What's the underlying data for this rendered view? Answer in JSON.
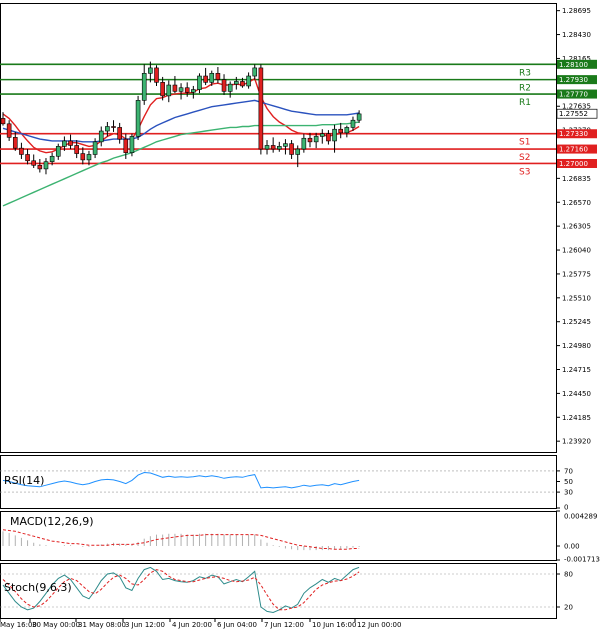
{
  "chart_data": [
    {
      "type": "candlestick",
      "panel": "price",
      "ylim": [
        1.238,
        1.2878
      ],
      "y_ticks": [
        "1.28695",
        "1.28430",
        "1.28165",
        "1.27635",
        "1.27370",
        "1.26835",
        "1.26570",
        "1.26305",
        "1.26040",
        "1.25775",
        "1.25510",
        "1.25245",
        "1.24980",
        "1.24715",
        "1.24450",
        "1.24185",
        "1.23920"
      ],
      "x_ticks": [
        "May 16:00",
        "30 May 00:00",
        "31 May 08:00",
        "3 Jun 12:00",
        "4 Jun 20:00",
        "6 Jun 04:00",
        "7 Jun 12:00",
        "10 Jun 16:00",
        "12 Jun 00:00"
      ],
      "levels": [
        {
          "label": "R3",
          "value": 1.281,
          "value_label": "1.28100",
          "color": "#1a7a1a"
        },
        {
          "label": "R2",
          "value": 1.2793,
          "value_label": "1.27930",
          "color": "#1a7a1a"
        },
        {
          "label": "R1",
          "value": 1.2777,
          "value_label": "1.27770",
          "color": "#1a7a1a"
        },
        {
          "label": "S1",
          "value": 1.2733,
          "value_label": "1.27330",
          "color": "#e02020"
        },
        {
          "label": "S2",
          "value": 1.2716,
          "value_label": "1.27160",
          "color": "#e02020"
        },
        {
          "label": "S3",
          "value": 1.27,
          "value_label": "1.27000",
          "color": "#e02020"
        }
      ],
      "current_price": {
        "value": 1.27552,
        "label": "1.27552"
      },
      "candles": [
        [
          1.275,
          1.2757,
          1.2742,
          1.2744
        ],
        [
          1.2744,
          1.2748,
          1.2725,
          1.2729
        ],
        [
          1.2729,
          1.2735,
          1.2714,
          1.2717
        ],
        [
          1.2717,
          1.2723,
          1.2705,
          1.271
        ],
        [
          1.271,
          1.2716,
          1.2699,
          1.2703
        ],
        [
          1.2703,
          1.271,
          1.2695,
          1.2698
        ],
        [
          1.2698,
          1.2705,
          1.269,
          1.2694
        ],
        [
          1.2694,
          1.2706,
          1.2688,
          1.2702
        ],
        [
          1.2702,
          1.2712,
          1.2698,
          1.2708
        ],
        [
          1.2708,
          1.2722,
          1.2704,
          1.2719
        ],
        [
          1.2719,
          1.273,
          1.2714,
          1.2725
        ],
        [
          1.2725,
          1.2732,
          1.2716,
          1.272
        ],
        [
          1.272,
          1.2726,
          1.2706,
          1.2711
        ],
        [
          1.2711,
          1.2718,
          1.2699,
          1.2704
        ],
        [
          1.2704,
          1.2714,
          1.2698,
          1.271
        ],
        [
          1.271,
          1.2728,
          1.2706,
          1.2724
        ],
        [
          1.2724,
          1.2741,
          1.2719,
          1.2736
        ],
        [
          1.2736,
          1.2746,
          1.273,
          1.2741
        ],
        [
          1.2741,
          1.2748,
          1.2735,
          1.274
        ],
        [
          1.274,
          1.2745,
          1.2722,
          1.2727
        ],
        [
          1.2727,
          1.2733,
          1.2705,
          1.2712
        ],
        [
          1.2712,
          1.2733,
          1.2708,
          1.273
        ],
        [
          1.273,
          1.2775,
          1.2726,
          1.277
        ],
        [
          1.277,
          1.281,
          1.2765,
          1.28
        ],
        [
          1.28,
          1.2813,
          1.279,
          1.2806
        ],
        [
          1.2806,
          1.2809,
          1.2786,
          1.279
        ],
        [
          1.279,
          1.2796,
          1.277,
          1.2775
        ],
        [
          1.2775,
          1.2792,
          1.2768,
          1.2787
        ],
        [
          1.2787,
          1.2797,
          1.2778,
          1.278
        ],
        [
          1.278,
          1.2789,
          1.2771,
          1.2784
        ],
        [
          1.2784,
          1.279,
          1.2774,
          1.2779
        ],
        [
          1.2779,
          1.2786,
          1.2772,
          1.2782
        ],
        [
          1.2782,
          1.28,
          1.2778,
          1.2797
        ],
        [
          1.2797,
          1.2806,
          1.2787,
          1.279
        ],
        [
          1.279,
          1.2803,
          1.2786,
          1.28
        ],
        [
          1.28,
          1.2807,
          1.2789,
          1.2793
        ],
        [
          1.2793,
          1.2799,
          1.2776,
          1.278
        ],
        [
          1.278,
          1.2791,
          1.2773,
          1.2788
        ],
        [
          1.2788,
          1.2796,
          1.2782,
          1.2791
        ],
        [
          1.2791,
          1.2795,
          1.2784,
          1.2786
        ],
        [
          1.2786,
          1.2801,
          1.2783,
          1.2797
        ],
        [
          1.2797,
          1.281,
          1.2793,
          1.2806
        ],
        [
          1.2806,
          1.281,
          1.271,
          1.2716
        ],
        [
          1.2716,
          1.2726,
          1.271,
          1.272
        ],
        [
          1.272,
          1.2729,
          1.2712,
          1.2716
        ],
        [
          1.2716,
          1.2724,
          1.2713,
          1.2719
        ],
        [
          1.2719,
          1.2727,
          1.271,
          1.2722
        ],
        [
          1.2722,
          1.2726,
          1.2705,
          1.271
        ],
        [
          1.271,
          1.272,
          1.2696,
          1.2716
        ],
        [
          1.2716,
          1.2733,
          1.2712,
          1.2728
        ],
        [
          1.2728,
          1.2734,
          1.2718,
          1.2724
        ],
        [
          1.2724,
          1.2734,
          1.2717,
          1.273
        ],
        [
          1.273,
          1.2738,
          1.2722,
          1.2733
        ],
        [
          1.2733,
          1.2737,
          1.2721,
          1.2725
        ],
        [
          1.2725,
          1.2743,
          1.2712,
          1.2738
        ],
        [
          1.2738,
          1.2745,
          1.2728,
          1.2734
        ],
        [
          1.2734,
          1.2742,
          1.2729,
          1.274
        ],
        [
          1.274,
          1.2752,
          1.2736,
          1.2748
        ],
        [
          1.2748,
          1.2759,
          1.2745,
          1.2755
        ]
      ],
      "series": [
        {
          "name": "",
          "color": "#e02020",
          "values": [
            1.2755,
            1.275,
            1.2742,
            1.2733,
            1.2725,
            1.2718,
            1.2714,
            1.2712,
            1.2713,
            1.2716,
            1.272,
            1.2723,
            1.2723,
            1.2721,
            1.2719,
            1.272,
            1.2725,
            1.273,
            1.2733,
            1.2732,
            1.2727,
            1.2727,
            1.2738,
            1.2752,
            1.2765,
            1.2772,
            1.2773,
            1.2776,
            1.2777,
            1.2778,
            1.2778,
            1.2779,
            1.2783,
            1.2784,
            1.2788,
            1.2789,
            1.2787,
            1.2787,
            1.2788,
            1.2787,
            1.279,
            1.2794,
            1.2774,
            1.2761,
            1.2752,
            1.2746,
            1.2742,
            1.2737,
            1.2734,
            1.2733,
            1.2732,
            1.2732,
            1.2732,
            1.273,
            1.2732,
            1.2733,
            1.2734,
            1.2737,
            1.2741
          ]
        },
        {
          "name": "",
          "color": "#2a52be",
          "values": [
            1.2739,
            1.2737,
            1.2735,
            1.2733,
            1.2731,
            1.2729,
            1.2727,
            1.2726,
            1.2725,
            1.2725,
            1.2725,
            1.2725,
            1.2725,
            1.2724,
            1.2724,
            1.2724,
            1.2725,
            1.2726,
            1.2727,
            1.2727,
            1.2727,
            1.2727,
            1.2729,
            1.2733,
            1.2738,
            1.2742,
            1.2745,
            1.2748,
            1.2751,
            1.2753,
            1.2755,
            1.2757,
            1.2759,
            1.2761,
            1.2763,
            1.2764,
            1.2765,
            1.2766,
            1.2767,
            1.2768,
            1.2769,
            1.277,
            1.2768,
            1.2766,
            1.2764,
            1.2762,
            1.276,
            1.2758,
            1.2757,
            1.2756,
            1.2755,
            1.2754,
            1.2754,
            1.2754,
            1.2754,
            1.2754,
            1.2754,
            1.2755,
            1.2756
          ]
        },
        {
          "name": "",
          "color": "#3cb371",
          "values": [
            1.2653,
            1.2656,
            1.2659,
            1.2662,
            1.2665,
            1.2668,
            1.2671,
            1.2674,
            1.2677,
            1.268,
            1.2683,
            1.2686,
            1.2689,
            1.2692,
            1.2695,
            1.2698,
            1.2701,
            1.2703,
            1.2706,
            1.2708,
            1.271,
            1.2712,
            1.2715,
            1.2718,
            1.2721,
            1.2724,
            1.2726,
            1.2728,
            1.273,
            1.2732,
            1.2733,
            1.2734,
            1.2735,
            1.2736,
            1.2737,
            1.2738,
            1.2739,
            1.274,
            1.274,
            1.2741,
            1.2741,
            1.2742,
            1.2742,
            1.2742,
            1.2742,
            1.2742,
            1.2742,
            1.2742,
            1.2742,
            1.2742,
            1.2742,
            1.2742,
            1.2743,
            1.2743,
            1.2743,
            1.2744,
            1.2744,
            1.2745,
            1.2746
          ]
        }
      ]
    },
    {
      "type": "line",
      "panel": "rsi",
      "title": "RSI(14)",
      "ylim": [
        0,
        100
      ],
      "y_ticks": [
        "70",
        "50",
        "30",
        "0"
      ],
      "series": [
        {
          "name": "",
          "color": "#1e90ff",
          "values": [
            52,
            50,
            47,
            44,
            42,
            41,
            40,
            43,
            46,
            49,
            51,
            49,
            46,
            44,
            46,
            50,
            53,
            54,
            53,
            50,
            46,
            52,
            62,
            67,
            66,
            62,
            58,
            60,
            58,
            59,
            58,
            59,
            61,
            59,
            61,
            59,
            56,
            58,
            59,
            58,
            61,
            63,
            38,
            39,
            38,
            39,
            40,
            38,
            40,
            43,
            41,
            43,
            44,
            42,
            46,
            44,
            47,
            50,
            52
          ]
        }
      ]
    },
    {
      "type": "line",
      "panel": "macd",
      "title": "MACD(12,26,9)",
      "ylim": [
        -0.001713,
        0.004289
      ],
      "y_ticks": [
        "0.004289",
        "0.00",
        "-0.001713"
      ],
      "series": [
        {
          "name": "",
          "color": "#b0b0b0",
          "values": [
            0.0018,
            0.0016,
            0.0013,
            0.001,
            0.0007,
            0.0004,
            0.0002,
            0.0001,
            0.0,
            0.0,
            0.0001,
            0.0001,
            0.0,
            -0.0001,
            -0.0001,
            0.0,
            0.0002,
            0.0003,
            0.0004,
            0.0003,
            0.0002,
            0.0002,
            0.0005,
            0.0009,
            0.0012,
            0.0014,
            0.0014,
            0.0015,
            0.0015,
            0.0015,
            0.0014,
            0.0014,
            0.0015,
            0.0015,
            0.0015,
            0.0015,
            0.0014,
            0.0014,
            0.0014,
            0.0013,
            0.0014,
            0.0014,
            0.0008,
            0.0004,
            0.0001,
            -0.0001,
            -0.0003,
            -0.0004,
            -0.0005,
            -0.0005,
            -0.0005,
            -0.0005,
            -0.0005,
            -0.0005,
            -0.0004,
            -0.0004,
            -0.0003,
            -0.0002,
            -0.0001
          ]
        },
        {
          "name": "",
          "color": "#e02020",
          "values": [
            0.002,
            0.0019,
            0.0018,
            0.0016,
            0.0014,
            0.0012,
            0.001,
            0.0008,
            0.0006,
            0.0005,
            0.0004,
            0.0003,
            0.0003,
            0.0002,
            0.0001,
            0.0001,
            0.0001,
            0.0001,
            0.0002,
            0.0002,
            0.0002,
            0.0002,
            0.0003,
            0.0004,
            0.0006,
            0.0008,
            0.0009,
            0.001,
            0.0011,
            0.0012,
            0.0013,
            0.0013,
            0.0013,
            0.0014,
            0.0014,
            0.0014,
            0.0014,
            0.0014,
            0.0014,
            0.0014,
            0.0014,
            0.0014,
            0.0013,
            0.0011,
            0.0009,
            0.0007,
            0.0005,
            0.0003,
            0.0001,
            0.0,
            -0.0001,
            -0.0002,
            -0.0003,
            -0.0003,
            -0.0004,
            -0.0004,
            -0.0004,
            -0.0003,
            -0.0003
          ]
        }
      ]
    },
    {
      "type": "line",
      "panel": "stoch",
      "title": "Stoch(9,6,3)",
      "ylim": [
        0,
        100
      ],
      "y_ticks": [
        "80",
        "20"
      ],
      "series": [
        {
          "name": "",
          "color": "#2e8b8b",
          "values": [
            60,
            45,
            30,
            20,
            15,
            18,
            30,
            45,
            60,
            72,
            78,
            70,
            55,
            40,
            35,
            50,
            68,
            80,
            82,
            75,
            55,
            50,
            72,
            88,
            92,
            85,
            70,
            72,
            68,
            66,
            65,
            68,
            75,
            72,
            78,
            75,
            62,
            66,
            70,
            66,
            75,
            85,
            20,
            12,
            10,
            15,
            22,
            18,
            25,
            45,
            55,
            62,
            70,
            65,
            72,
            68,
            78,
            88,
            92
          ]
        },
        {
          "name": "",
          "color": "#e02020",
          "values": [
            70,
            60,
            48,
            35,
            25,
            20,
            22,
            30,
            42,
            55,
            66,
            72,
            68,
            58,
            48,
            44,
            52,
            64,
            74,
            78,
            72,
            62,
            60,
            70,
            82,
            88,
            85,
            76,
            70,
            68,
            66,
            66,
            69,
            72,
            74,
            75,
            72,
            68,
            66,
            67,
            69,
            74,
            60,
            42,
            25,
            15,
            15,
            18,
            20,
            28,
            40,
            52,
            60,
            64,
            67,
            68,
            71,
            76,
            84
          ]
        }
      ]
    }
  ]
}
